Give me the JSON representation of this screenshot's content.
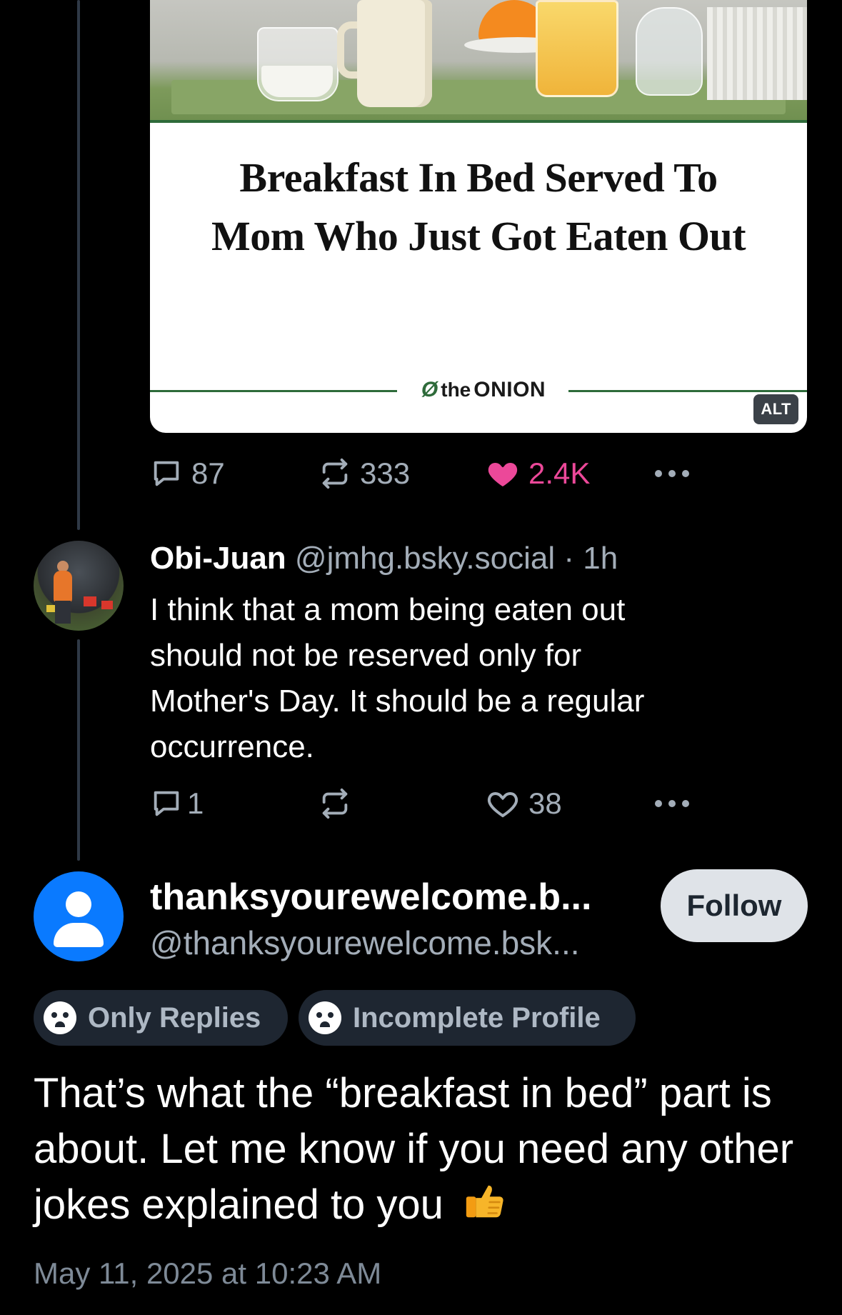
{
  "card": {
    "headline_line1": "Breakfast In Bed Served To",
    "headline_line2": "Mom Who Just Got Eaten Out",
    "publisher_the": "the",
    "publisher_name": "ONION",
    "alt_label": "ALT"
  },
  "original_post_actions": {
    "replies": "87",
    "reposts": "333",
    "likes": "2.4K",
    "like_color": "#ec4899"
  },
  "reply": {
    "author_name": "Obi-Juan",
    "handle": "@jmhg.bsky.social",
    "separator": "·",
    "time": "1h",
    "text_lines": [
      "I think that a mom being eaten out",
      "should not be reserved only for",
      "Mother's Day. It should be a regular",
      "occurrence."
    ],
    "actions": {
      "replies": "1",
      "reposts": "",
      "likes": "38"
    }
  },
  "main_post": {
    "author_name": "thanksyourewelcome.b...",
    "handle": "@thanksyourewelcome.bsk...",
    "follow_label": "Follow",
    "badges": [
      "Only Replies",
      "Incomplete Profile"
    ],
    "text": "That’s what the “breakfast in bed” part is about. Let me know if you need any other jokes explained to you",
    "emoji": "thumbs-up",
    "timestamp": "May 11, 2025 at 10:23 AM"
  },
  "colors": {
    "background": "#000000",
    "muted_text": "#a3adb8",
    "avatar_blue": "#0a7aff",
    "badge_bg": "#1e2631",
    "follow_bg": "#dfe3e8"
  }
}
